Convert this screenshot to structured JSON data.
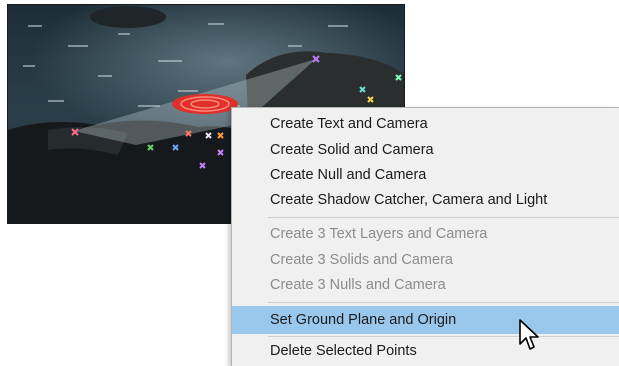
{
  "viewer": {
    "description": "Composition viewer showing rocky shore footage with 3D camera track points and ground-plane target"
  },
  "context_menu": {
    "items": [
      {
        "label": "Create Text and Camera",
        "enabled": true,
        "highlighted": false
      },
      {
        "label": "Create Solid and Camera",
        "enabled": true,
        "highlighted": false
      },
      {
        "label": "Create Null and Camera",
        "enabled": true,
        "highlighted": false
      },
      {
        "label": "Create Shadow Catcher, Camera and Light",
        "enabled": true,
        "highlighted": false
      },
      {
        "label": "Create 3 Text Layers and Camera",
        "enabled": false,
        "highlighted": false
      },
      {
        "label": "Create 3 Solids and Camera",
        "enabled": false,
        "highlighted": false
      },
      {
        "label": "Create 3 Nulls and Camera",
        "enabled": false,
        "highlighted": false
      },
      {
        "label": "Set Ground Plane and Origin",
        "enabled": true,
        "highlighted": true
      },
      {
        "label": "Delete Selected Points",
        "enabled": true,
        "highlighted": false
      }
    ]
  },
  "colors": {
    "highlight": "#99c8ec",
    "menu_background": "#f0f0f0",
    "disabled_text": "#8c8c8c",
    "target_red": "#e0302a"
  },
  "icons": {
    "cursor": "arrow-cursor-icon",
    "track_point": "track-point-icon",
    "target": "ground-plane-target-icon"
  }
}
